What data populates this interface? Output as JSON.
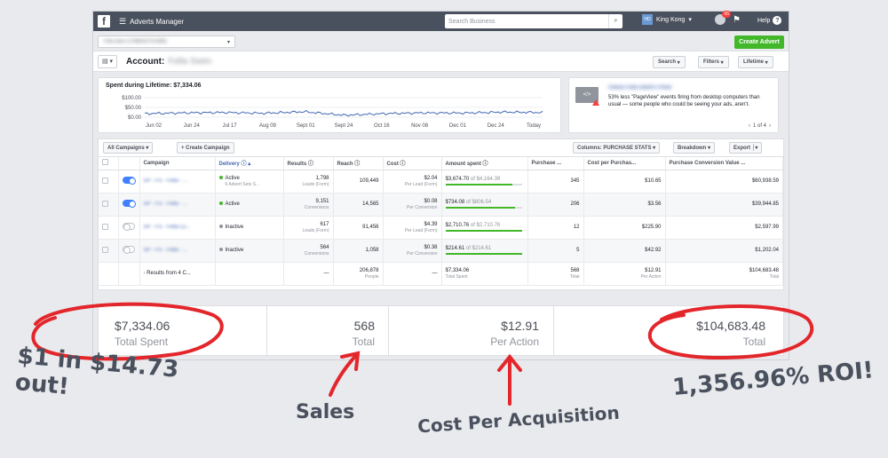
{
  "topbar": {
    "logo": "f",
    "menu_icon": "hamburger-icon",
    "app_name": "Adverts Manager",
    "search_placeholder": "Search Business",
    "user_initials": "HD",
    "user_name": "King Kong",
    "notification_count": "65",
    "help_label": "Help"
  },
  "account_row": {
    "selector_value": "Fella Swim (1708603272/19/80)",
    "create_label": "Create Advert"
  },
  "account_bar": {
    "title": "Account:",
    "name": "Fella Swim",
    "buttons": [
      "Search",
      "Filters",
      "Lifetime"
    ]
  },
  "spent_chart": {
    "title": "Spent during Lifetime: $7,334.06",
    "y_ticks": [
      "$100.00",
      "$50.00",
      "$0.00"
    ],
    "x_ticks": [
      "Jun 02",
      "Jun 24",
      "Jul 17",
      "Aug 09",
      "Sept 01",
      "Sept 24",
      "Oct 16",
      "Nov 08",
      "Dec 01",
      "Dec 24",
      "Today"
    ]
  },
  "chart_data": {
    "type": "line",
    "title": "Spent during Lifetime: $7,334.06",
    "x": [
      "Jun 02",
      "Jun 24",
      "Jul 17",
      "Aug 09",
      "Sept 01",
      "Sept 24",
      "Oct 16",
      "Nov 08",
      "Dec 01",
      "Dec 24",
      "Today"
    ],
    "series": [
      {
        "values": [
          18,
          22,
          24,
          20,
          28,
          10,
          18,
          22,
          21,
          26,
          24
        ]
      }
    ],
    "ylim": [
      0,
      100
    ],
    "grid": true
  },
  "pixel_card": {
    "link": "Check Fella Swim's Pixel",
    "text": "53% less \"PageView\" events firing from desktop computers than usual — some people who could be seeing your ads, aren't.",
    "pager": "1 of 4"
  },
  "table_toolbar": {
    "all_campaigns": "All Campaigns",
    "create_campaign": "+ Create Campaign",
    "columns": "Columns: PURCHASE STATS",
    "breakdown": "Breakdown",
    "export": "Export"
  },
  "columns": [
    "Campaign",
    "Delivery",
    "Results",
    "Reach",
    "Cost",
    "Amount spent",
    "Purchase ...",
    "Cost per Purchas...",
    "Purchase Conversion Value ..."
  ],
  "rows": [
    {
      "campaign": "SP - FS - Fella - ...",
      "toggle_on": true,
      "delivery": "Active",
      "delivery_sub": "6 Advert Sets S...",
      "status_color": "#42b72a",
      "results": "1,798",
      "results_sub": "Leads (Form)",
      "reach": "109,449",
      "cost": "$2.04",
      "cost_sub": "Per Lead (Form)",
      "spent": "$3,674.70",
      "spent_of": "of $4,164.39",
      "spent_fraction": 0.88,
      "purchases": "345",
      "cpp": "$10.65",
      "value": "$60,938.59"
    },
    {
      "campaign": "SP - FS - Fella - ...",
      "toggle_on": true,
      "delivery": "Active",
      "delivery_sub": "",
      "status_color": "#42b72a",
      "results": "9,151",
      "results_sub": "Conversions",
      "reach": "14,565",
      "cost": "$0.08",
      "cost_sub": "Per Conversion",
      "spent": "$734.08",
      "spent_of": "of $806.54",
      "spent_fraction": 0.91,
      "purchases": "206",
      "cpp": "$3.56",
      "value": "$39,944.85"
    },
    {
      "campaign": "SP - FS - Fella Lo...",
      "toggle_on": false,
      "delivery": "Inactive",
      "delivery_sub": "",
      "status_color": "#90949c",
      "results": "617",
      "results_sub": "Leads (Form)",
      "reach": "91,456",
      "cost": "$4.39",
      "cost_sub": "Per Lead (Form)",
      "spent": "$2,710.76",
      "spent_of": "of $2,710.76",
      "spent_fraction": 1.0,
      "purchases": "12",
      "cpp": "$225.90",
      "value": "$2,597.99"
    },
    {
      "campaign": "SP - FS - Fella - ...",
      "toggle_on": false,
      "delivery": "Inactive",
      "delivery_sub": "",
      "status_color": "#90949c",
      "results": "564",
      "results_sub": "Conversions",
      "reach": "1,058",
      "cost": "$0.38",
      "cost_sub": "Per Conversion",
      "spent": "$214.61",
      "spent_of": "of $214.61",
      "spent_fraction": 1.0,
      "purchases": "5",
      "cpp": "$42.92",
      "value": "$1,202.04"
    }
  ],
  "totals": {
    "label": "Results from 4 C...",
    "results": "—",
    "reach": "206,878",
    "reach_sub": "People",
    "cost": "—",
    "spent": "$7,334.06",
    "spent_sub": "Total Spent",
    "purchases": "568",
    "purchases_sub": "Total",
    "cpp": "$12.91",
    "cpp_sub": "Per Action",
    "value": "$104,683.48",
    "value_sub": "Total"
  },
  "summary": [
    {
      "value": "$7,334.06",
      "label": "Total Spent"
    },
    {
      "value": "568",
      "label": "Total"
    },
    {
      "value": "$12.91",
      "label": "Per Action"
    },
    {
      "value": "$104,683.48",
      "label": "Total"
    }
  ],
  "annotations": {
    "roi_left": "$1 in $14.73 out!",
    "sales": "Sales",
    "cpa": "Cost Per Acquisition",
    "roi_right": "1,356.96% ROI!"
  },
  "colors": {
    "topbar": "#4a515e",
    "accent_blue": "#4267b2",
    "green": "#42b72a",
    "annotation_red": "#e3262b"
  }
}
